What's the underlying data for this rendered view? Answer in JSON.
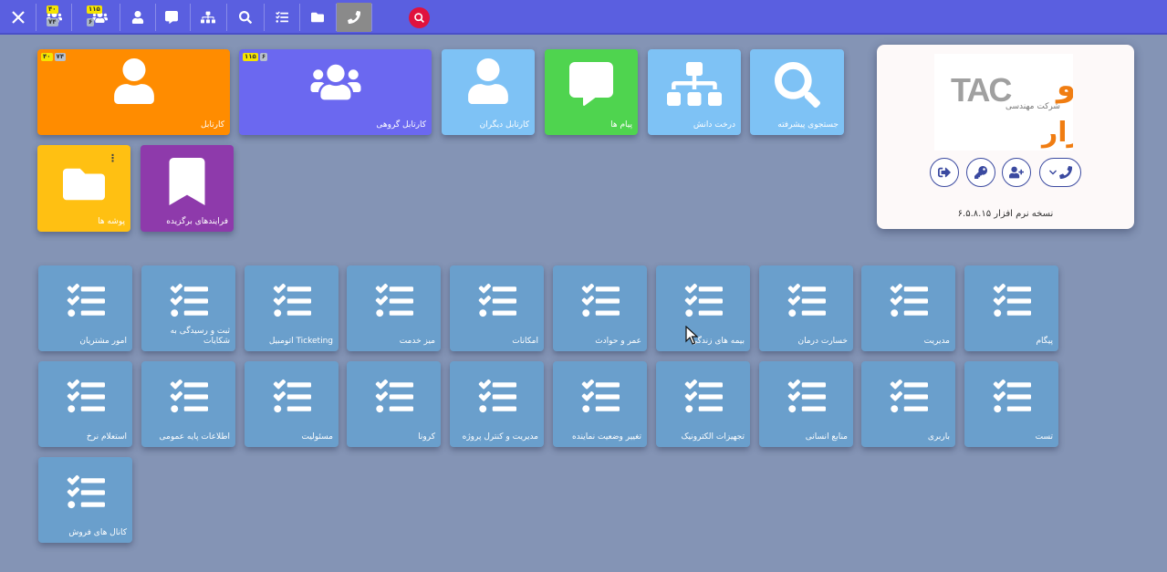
{
  "toolbar": {
    "items": [
      {
        "icon": "close-icon"
      },
      {
        "icon": "group-icon",
        "badges": [
          "۴۰",
          "۷۴"
        ]
      },
      {
        "icon": "group-icon",
        "badges": [
          "۱۱۵",
          "۶"
        ]
      },
      {
        "icon": "user-icon"
      },
      {
        "icon": "comment-icon"
      },
      {
        "icon": "sitemap-icon"
      },
      {
        "icon": "search-icon"
      },
      {
        "icon": "tasks-icon"
      },
      {
        "icon": "folder-icon"
      },
      {
        "icon": "phone-icon",
        "active": true
      }
    ],
    "search_icon": "search-icon"
  },
  "tiles": [
    {
      "label": "کارتابل",
      "color": "#ff8c00",
      "icon": "user-icon",
      "badges": [
        "۴۰",
        "۷۴"
      ]
    },
    {
      "label": "کارتابل گروهی",
      "color": "#6b68f0",
      "icon": "group-icon",
      "badges": [
        "۱۱۵",
        "۶"
      ]
    },
    {
      "label": "کارتابل دیگران",
      "color": "#7ec2f5",
      "icon": "user-icon"
    },
    {
      "label": "پیام ها",
      "color": "#4fd44f",
      "icon": "comment-icon"
    },
    {
      "label": "درخت دانش",
      "color": "#7ec2f5",
      "icon": "sitemap-icon"
    },
    {
      "label": "جستجوی پیشرفته",
      "color": "#7ec2f5",
      "icon": "search-icon"
    },
    {
      "label": "پوشه ها",
      "color": "#ffc012",
      "icon": "folder-icon"
    },
    {
      "label": "فرایندهای برگزیده",
      "color": "#8e3aab",
      "icon": "bookmark-icon"
    }
  ],
  "processes": [
    "امور مشتریان",
    "ثبت و رسیدگی به شکایات",
    "Ticketing اتومبیل",
    "میز خدمت",
    "امکانات",
    "عمر و حوادث",
    "بیمه های زندگی",
    "خسارت درمان",
    "مدیریت",
    "پیگام",
    "استعلام نرخ",
    "اطلاعات پایه عمومی",
    "مسئولیت",
    "کرونا",
    "مدیریت و کنترل پروژه",
    "تغییر وضعیت نماینده",
    "تجهیزات الکترونیک",
    "منابع انسانی",
    "باربری",
    "تست",
    "کانال های فروش"
  ],
  "panel": {
    "logo_text_main": "تدرو",
    "logo_text_latin": "TAC",
    "logo_text_sub": "افزار",
    "logo_text_company": "شرکت مهندسی",
    "buttons": [
      "phone-icon",
      "user-plus-icon",
      "key-icon",
      "sign-out-icon"
    ],
    "version": "نسخه نرم افزار ۶.۵.۸.۱۵"
  }
}
